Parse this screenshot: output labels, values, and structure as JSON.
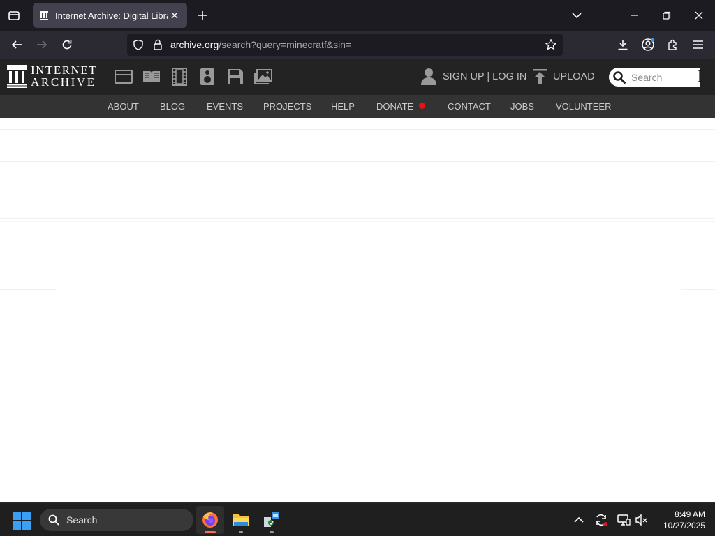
{
  "browser": {
    "tab": {
      "title": "Internet Archive: Digital Library"
    },
    "url": {
      "host": "archive.org",
      "path": "/search?query=minecratf&sin="
    }
  },
  "ia": {
    "logo": {
      "line1": "INTERNET",
      "line2": "ARCHIVE"
    },
    "account_label": "SIGN UP | LOG IN",
    "upload_label": "UPLOAD",
    "search_placeholder": "Search",
    "nav": [
      {
        "label": "ABOUT"
      },
      {
        "label": "BLOG"
      },
      {
        "label": "EVENTS"
      },
      {
        "label": "PROJECTS"
      },
      {
        "label": "HELP"
      },
      {
        "label": "DONATE"
      },
      {
        "label": "CONTACT"
      },
      {
        "label": "JOBS"
      },
      {
        "label": "VOLUNTEER"
      }
    ]
  },
  "taskbar": {
    "search_label": "Search",
    "time": "8:49 AM",
    "date": "10/27/2025"
  },
  "colors": {
    "tab_strip": "#1c1b22",
    "toolbar": "#2b2a33",
    "ia_header": "#232323",
    "ia_nav": "#333333",
    "donate_dot": "#ee1111",
    "taskbar": "#1f1f1f"
  }
}
